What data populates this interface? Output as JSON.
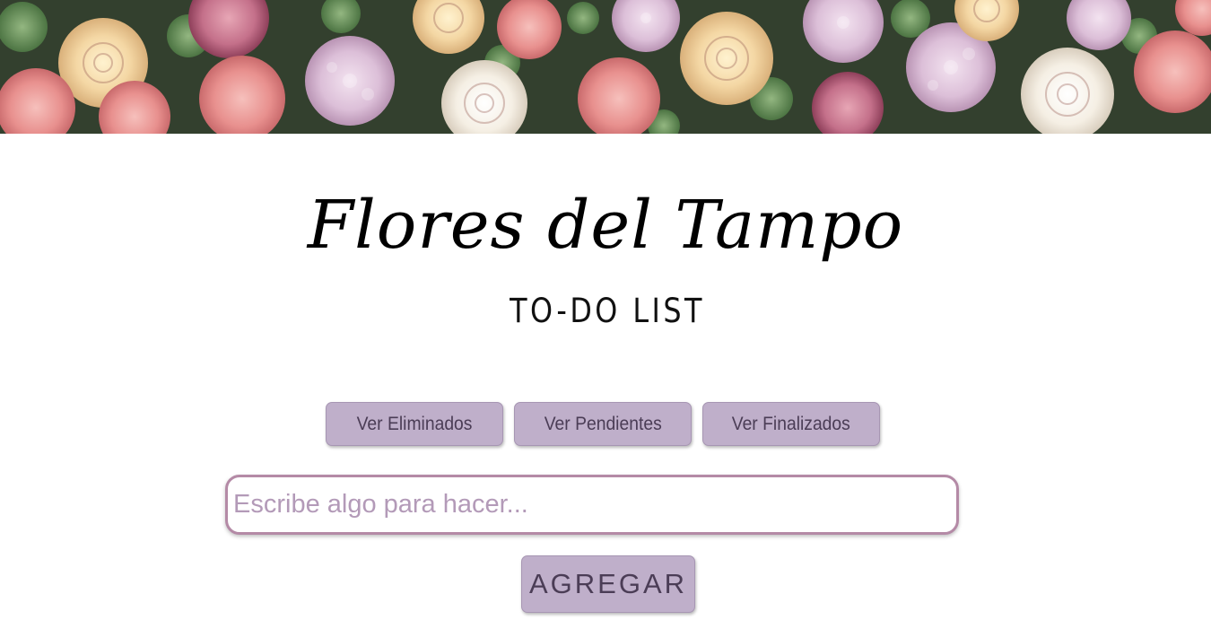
{
  "header": {
    "title": "Flores del Tampo",
    "subtitle": "TO-DO LIST"
  },
  "filters": {
    "deleted_label": "Ver Eliminados",
    "pending_label": "Ver Pendientes",
    "finished_label": "Ver Finalizados"
  },
  "task_input": {
    "value": "",
    "placeholder": "Escribe algo para hacer..."
  },
  "add_button": {
    "label": "AGREGAR"
  },
  "colors": {
    "button_background": "#bfafca",
    "button_text": "#4b3d56",
    "input_border": "#b48aa6",
    "placeholder": "#b39ab8"
  }
}
